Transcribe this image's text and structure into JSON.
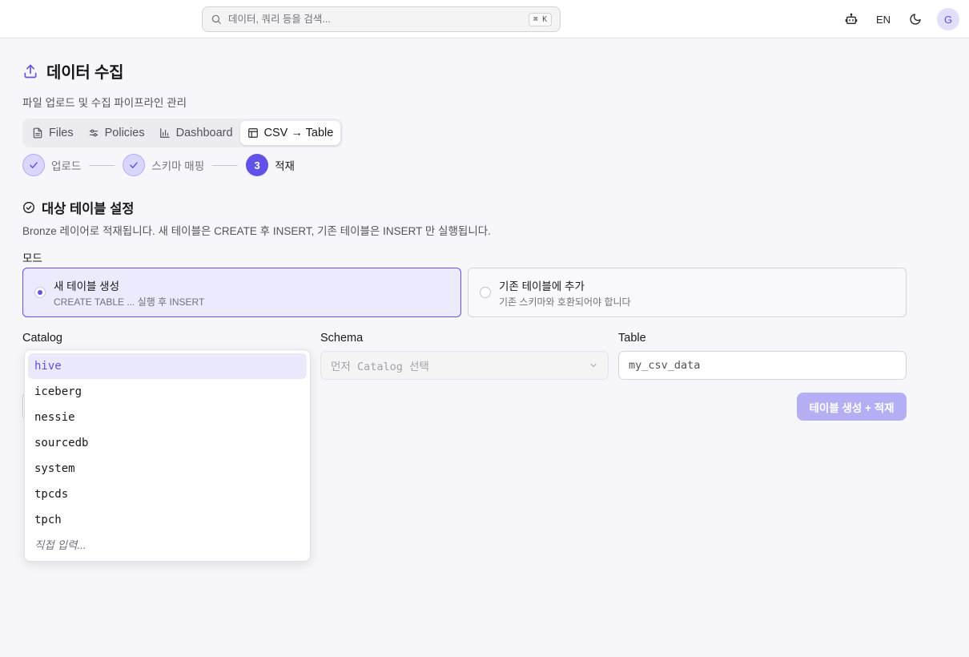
{
  "topbar": {
    "search_placeholder": "데이터, 쿼리 등을 검색...",
    "shortcut": "⌘ K",
    "lang": "EN",
    "avatar_initial": "G"
  },
  "header": {
    "title": "데이터 수집",
    "subtitle": "파일 업로드 및 수집 파이프라인 관리"
  },
  "tabs": [
    {
      "label": "Files",
      "icon": "file-icon",
      "active": false
    },
    {
      "label": "Policies",
      "icon": "sliders-icon",
      "active": false
    },
    {
      "label": "Dashboard",
      "icon": "bar-chart-icon",
      "active": false
    },
    {
      "label": "CSV → Table",
      "icon": "table-icon",
      "active": true
    }
  ],
  "stepper": {
    "steps": [
      {
        "label": "업로드",
        "state": "done"
      },
      {
        "label": "스키마 매핑",
        "state": "done"
      },
      {
        "label": "적재",
        "state": "current",
        "number": "3"
      }
    ]
  },
  "section": {
    "title": "대상 테이블 설정",
    "description": "Bronze 레이어로 적재됩니다. 새 테이블은 CREATE 후 INSERT, 기존 테이블은 INSERT 만 실행됩니다.",
    "mode_label": "모드",
    "modes": [
      {
        "title": "새 테이블 생성",
        "subtitle": "CREATE TABLE ... 실행 후 INSERT",
        "selected": true
      },
      {
        "title": "기존 테이블에 추가",
        "subtitle": "기존 스키마와 호환되어야 합니다",
        "selected": false
      }
    ]
  },
  "fields": {
    "catalog_label": "Catalog",
    "schema_label": "Schema",
    "schema_placeholder": "먼저 Catalog 선택",
    "table_label": "Table",
    "table_value": "my_csv_data"
  },
  "catalog_dropdown": {
    "options": [
      "hive",
      "iceberg",
      "nessie",
      "sourcedb",
      "system",
      "tpcds",
      "tpch"
    ],
    "highlighted": "hive",
    "manual_entry": "직접 입력..."
  },
  "submit_label": "테이블 생성 + 적재",
  "colors": {
    "accent": "#6153e8",
    "accent_light": "#ecebfd",
    "disabled_button": "#b4aef5"
  }
}
